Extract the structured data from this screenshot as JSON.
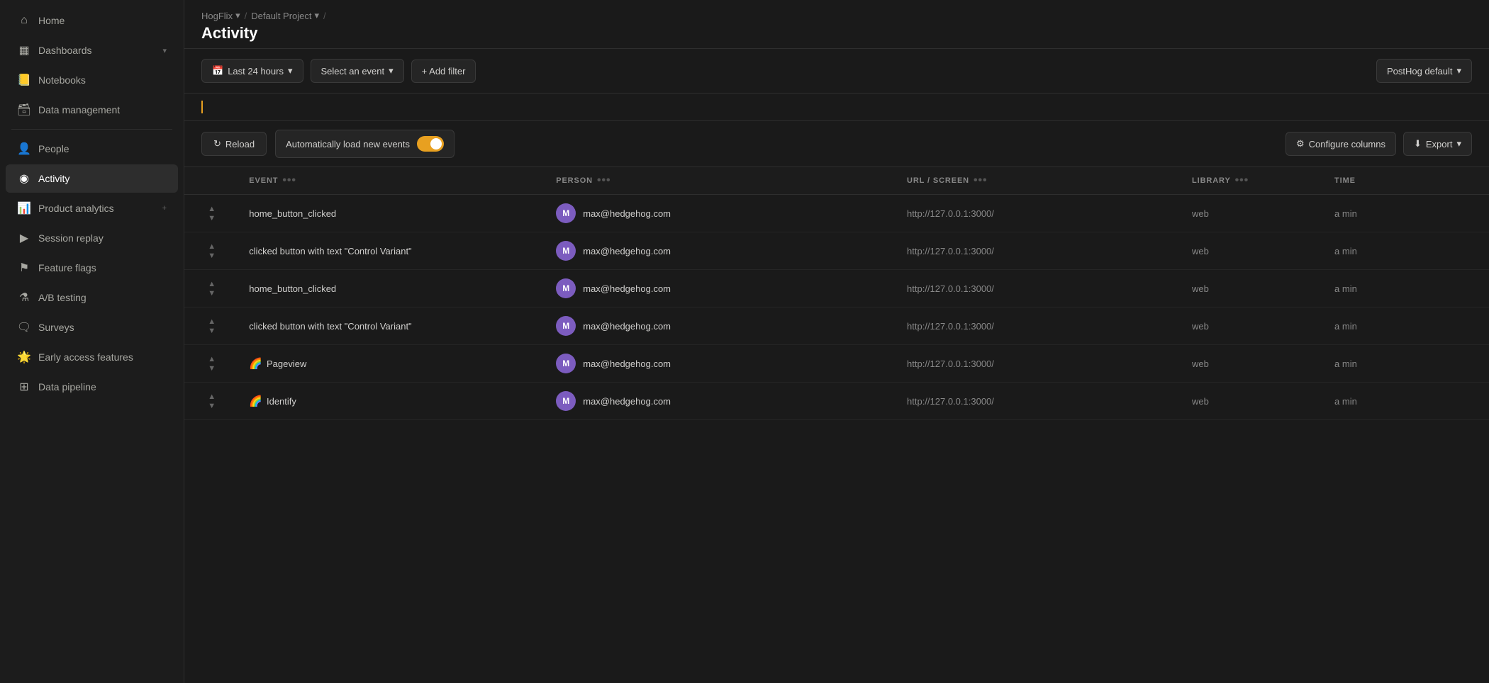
{
  "sidebar": {
    "items": [
      {
        "id": "home",
        "label": "Home",
        "icon": "🏠",
        "active": false
      },
      {
        "id": "dashboards",
        "label": "Dashboards",
        "icon": "⊞",
        "active": false,
        "hasChevron": true,
        "hasDivider": true
      },
      {
        "id": "notebooks",
        "label": "Notebooks",
        "icon": "📓",
        "active": false
      },
      {
        "id": "data-management",
        "label": "Data management",
        "icon": "🗄",
        "active": false
      },
      {
        "id": "people",
        "label": "People",
        "icon": "👥",
        "active": false
      },
      {
        "id": "activity",
        "label": "Activity",
        "icon": "📡",
        "active": true
      },
      {
        "id": "product-analytics",
        "label": "Product analytics",
        "icon": "📊",
        "active": false,
        "hasPlus": true
      },
      {
        "id": "session-replay",
        "label": "Session replay",
        "icon": "▶",
        "active": false
      },
      {
        "id": "feature-flags",
        "label": "Feature flags",
        "icon": "🚩",
        "active": false
      },
      {
        "id": "ab-testing",
        "label": "A/B testing",
        "icon": "🧪",
        "active": false
      },
      {
        "id": "surveys",
        "label": "Surveys",
        "icon": "💬",
        "active": false
      },
      {
        "id": "early-access",
        "label": "Early access features",
        "icon": "✨",
        "active": false
      },
      {
        "id": "data-pipeline",
        "label": "Data pipeline",
        "icon": "🔧",
        "active": false
      }
    ]
  },
  "breadcrumb": {
    "parts": [
      {
        "label": "HogFlix",
        "hasChevron": true
      },
      {
        "label": "Default Project",
        "hasChevron": true
      }
    ]
  },
  "page": {
    "title": "Activity"
  },
  "toolbar": {
    "time_filter_label": "Last 24 hours",
    "event_filter_label": "Select an event",
    "add_filter_label": "+ Add filter",
    "posthog_default_label": "PostHog default"
  },
  "action_bar": {
    "reload_label": "Reload",
    "auto_load_label": "Automatically load new events",
    "configure_columns_label": "Configure columns",
    "export_label": "Export"
  },
  "table": {
    "columns": [
      {
        "id": "expand",
        "label": ""
      },
      {
        "id": "event",
        "label": "EVENT"
      },
      {
        "id": "person",
        "label": "PERSON"
      },
      {
        "id": "url",
        "label": "URL / SCREEN"
      },
      {
        "id": "library",
        "label": "LIBRARY"
      },
      {
        "id": "time",
        "label": "TIME"
      }
    ],
    "rows": [
      {
        "event": "home_button_clicked",
        "hasIcon": false,
        "iconType": null,
        "person": "max@hedgehog.com",
        "url": "http://127.0.0.1:3000/",
        "library": "web",
        "time": "a min"
      },
      {
        "event": "clicked button with text \"Control Variant\"",
        "hasIcon": false,
        "iconType": null,
        "person": "max@hedgehog.com",
        "url": "http://127.0.0.1:3000/",
        "library": "web",
        "time": "a min"
      },
      {
        "event": "home_button_clicked",
        "hasIcon": false,
        "iconType": null,
        "person": "max@hedgehog.com",
        "url": "http://127.0.0.1:3000/",
        "library": "web",
        "time": "a min"
      },
      {
        "event": "clicked button with text \"Control Variant\"",
        "hasIcon": false,
        "iconType": null,
        "person": "max@hedgehog.com",
        "url": "http://127.0.0.1:3000/",
        "library": "web",
        "time": "a min"
      },
      {
        "event": "Pageview",
        "hasIcon": true,
        "iconType": "rainbow",
        "person": "max@hedgehog.com",
        "url": "http://127.0.0.1:3000/",
        "library": "web",
        "time": "a min"
      },
      {
        "event": "Identify",
        "hasIcon": true,
        "iconType": "rainbow",
        "person": "max@hedgehog.com",
        "url": "http://127.0.0.1:3000/",
        "library": "web",
        "time": "a min"
      }
    ]
  }
}
